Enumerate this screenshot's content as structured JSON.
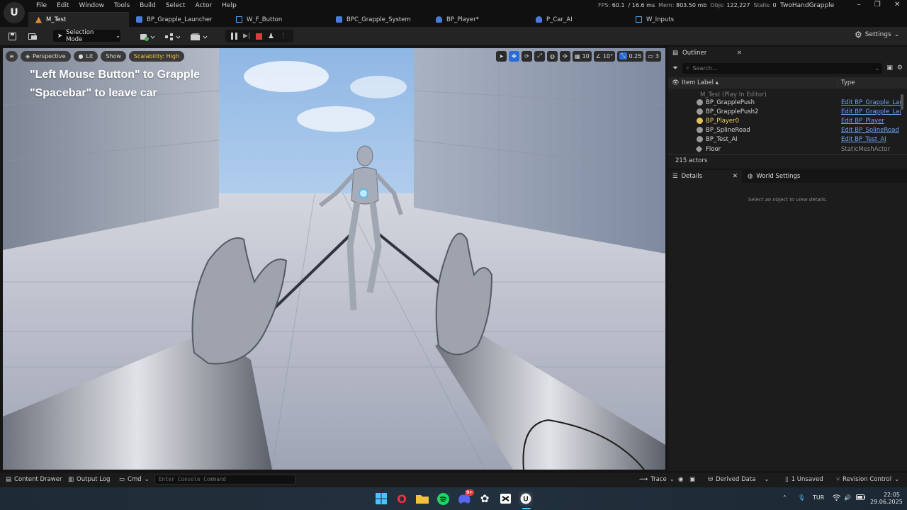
{
  "menu": [
    "File",
    "Edit",
    "Window",
    "Tools",
    "Build",
    "Select",
    "Actor",
    "Help"
  ],
  "stats": {
    "fps_label": "FPS:",
    "fps": "60.1",
    "ms": "/ 16.6 ms",
    "mem_label": "Mem:",
    "mem": "803.50 mb",
    "objs_label": "Objs:",
    "objs": "122,227",
    "stalls_label": "Stalls:",
    "stalls": "0"
  },
  "project_name": "TwoHandGrapple",
  "tabs": [
    {
      "label": "M_Test",
      "color": "#e08a2a"
    },
    {
      "label": "BP_Grapple_Launcher",
      "color": "#4a7bd8"
    },
    {
      "label": "W_F_Button",
      "color": "#5aa0e0"
    },
    {
      "label": "BPC_Grapple_System",
      "color": "#4a7bd8"
    },
    {
      "label": "BP_Player*",
      "color": "#4a7bd8"
    },
    {
      "label": "P_Car_AI",
      "color": "#4a7bd8"
    },
    {
      "label": "W_Inputs",
      "color": "#5aa0e0"
    }
  ],
  "toolbar": {
    "selection_mode": "Selection Mode",
    "settings": "Settings"
  },
  "viewport": {
    "perspective": "Perspective",
    "lit": "Lit",
    "show": "Show",
    "scalability": "Scalability: High",
    "grid_snap": "10",
    "rot_snap": "10°",
    "scale_snap": "0.25",
    "camera_speed": "3",
    "hint_line1": "\"Left Mouse Button\" to Grapple",
    "hint_line2": "\"Spacebar\" to leave car"
  },
  "outliner": {
    "title": "Outliner",
    "search_placeholder": "Search...",
    "col_label": "Item Label ▴",
    "col_type": "Type",
    "root": "M_Test (Play In Editor)",
    "rows": [
      {
        "label": "BP_GrapplePush",
        "type": "Edit BP_Grapple_Laur",
        "link": true
      },
      {
        "label": "BP_GrapplePush2",
        "type": "Edit BP_Grapple_Laur",
        "link": true
      },
      {
        "label": "BP_Player0",
        "type": "Edit BP_Player",
        "link": true
      },
      {
        "label": "BP_SplineRoad",
        "type": "Edit BP_SplineRoad",
        "link": true
      },
      {
        "label": "BP_Test_AI",
        "type": "Edit BP_Test_AI",
        "link": true
      },
      {
        "label": "Floor",
        "type": "StaticMeshActor",
        "link": false
      }
    ],
    "actor_count": "215 actors"
  },
  "details": {
    "tab_details": "Details",
    "tab_world": "World Settings",
    "empty_msg": "Select an object to view details."
  },
  "status": {
    "content_drawer": "Content Drawer",
    "output_log": "Output Log",
    "cmd": "Cmd",
    "console_placeholder": "Enter Console Command",
    "trace": "Trace",
    "derived_data": "Derived Data",
    "unsaved": "1 Unsaved",
    "revision_control": "Revision Control"
  },
  "taskbar": {
    "discord_badge": "9+",
    "lang": "TUR",
    "time": "22:05",
    "date": "29.06.2025"
  }
}
